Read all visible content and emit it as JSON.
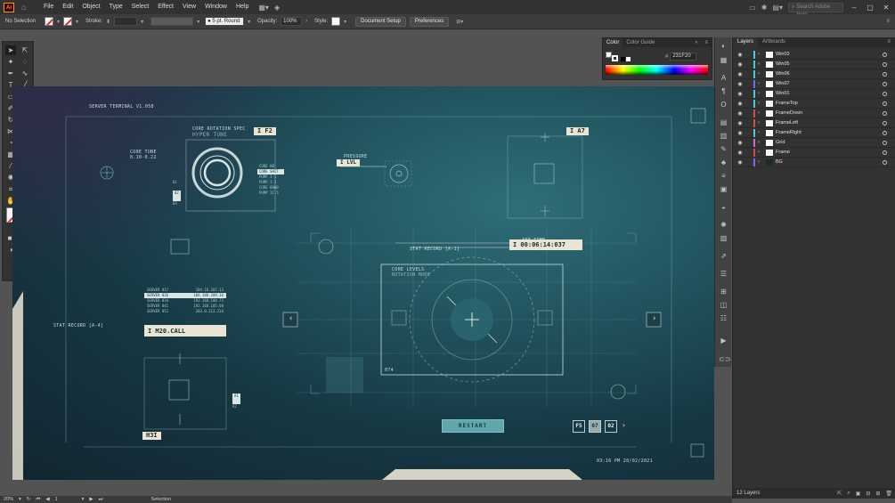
{
  "menubar": {
    "logo": "Ai",
    "items": [
      "File",
      "Edit",
      "Object",
      "Type",
      "Select",
      "Effect",
      "View",
      "Window",
      "Help"
    ],
    "search_placeholder": "Search Adobe Help"
  },
  "controlbar": {
    "selection": "No Selection",
    "stroke_label": "Stroke:",
    "brush": "5 pt. Round",
    "opacity_label": "Opacity:",
    "opacity_value": "100%",
    "style_label": "Style:",
    "document_setup": "Document Setup",
    "preferences": "Preferences"
  },
  "color_panel": {
    "tabs": [
      "Color",
      "Color Guide"
    ],
    "hex_label": "#",
    "hex_value": "231F20"
  },
  "layers_panel": {
    "tabs": [
      "Layers",
      "Artboards"
    ],
    "layers": [
      {
        "name": "Win03",
        "color": "#4ec8d9"
      },
      {
        "name": "Win05",
        "color": "#4ec8d9"
      },
      {
        "name": "Win06",
        "color": "#4ec8d9"
      },
      {
        "name": "Win07",
        "color": "#6f6fe6"
      },
      {
        "name": "Win01",
        "color": "#4ec8d9"
      },
      {
        "name": "FrameTop",
        "color": "#4ec8d9"
      },
      {
        "name": "FrameDown",
        "color": "#d84a4a"
      },
      {
        "name": "FrameLeft",
        "color": "#d84a4a"
      },
      {
        "name": "FrameRight",
        "color": "#4ec8d9"
      },
      {
        "name": "Grid",
        "color": "#d56ad5"
      },
      {
        "name": "Frame",
        "color": "#d84a4a"
      },
      {
        "name": "BG",
        "color": "#6f6fe6"
      }
    ],
    "count": "12 Layers"
  },
  "statusbar": {
    "zoom": "20%",
    "artboard": "1",
    "tool": "Selection"
  },
  "hud": {
    "server_title": "SERVER TERMINAL V1.058",
    "core_rotation": "CORE ROTATION SPEC",
    "hyper_tune": "HYPER TUNE",
    "core_tune": "CORE TUNE",
    "core_tune_val": "0.10-0.22",
    "f2": "I F2",
    "pressure": "PRESSURE",
    "lvl": "I LVL",
    "a7": "I A7",
    "stat_record": "STAT RECORD [A-1]",
    "app_time_label": "APP TIME",
    "app_time": "I 00:06:14:037",
    "core_levels": "CORE LEVELS",
    "rotation_mode": "ROTATION MODE",
    "code_074": "074",
    "stat_record_left": "STAT RECORD [A-4]",
    "m20": "I M20.CALL",
    "h3": "H3I",
    "restart": "RESTART",
    "pages": [
      "F5",
      "07",
      "02"
    ],
    "timestamp": "03:16 PM 28/02/2021",
    "server_rows": [
      [
        "SERVER 017",
        "104.16.207.13"
      ],
      [
        "SERVER 026",
        "104.108.209.16"
      ],
      [
        "SERVER 034",
        "192.168.100.71"
      ],
      [
        "SERVER 041",
        "192.168.105.08"
      ],
      [
        "SERVER 052",
        "203.0.113.216"
      ]
    ],
    "menu_rows": [
      "CORE HB",
      "CORE SHIT",
      "PUMP I-1",
      "PUMP I-2",
      "CORE 8800",
      "PUMP II-5"
    ],
    "num_left": [
      "01",
      "02",
      "03"
    ],
    "num_right": [
      "A1",
      "A2"
    ]
  }
}
